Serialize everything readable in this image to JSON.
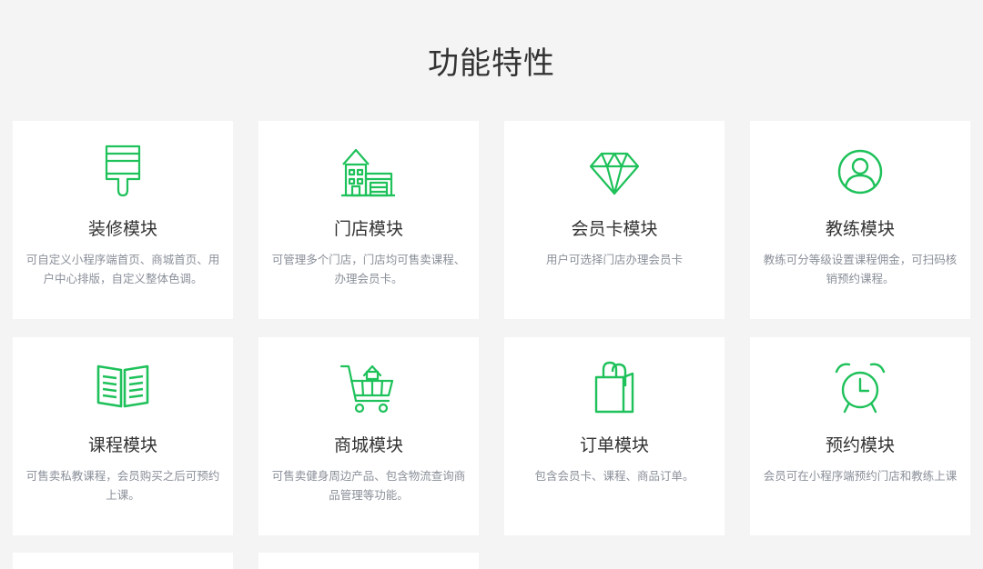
{
  "page": {
    "title": "功能特性"
  },
  "colors": {
    "background": "#f4f4f4",
    "card": "#ffffff",
    "accent": "#1ec15a",
    "title_text": "#333333",
    "desc_text": "#8a8f99"
  },
  "features": [
    {
      "icon": "paint-brush-icon",
      "name": "装修模块",
      "desc": "可自定义小程序端首页、商城首页、用户中心排版，自定义整体色调。"
    },
    {
      "icon": "store-house-icon",
      "name": "门店模块",
      "desc": "可管理多个门店，门店均可售卖课程、办理会员卡。"
    },
    {
      "icon": "diamond-icon",
      "name": "会员卡模块",
      "desc": "用户可选择门店办理会员卡"
    },
    {
      "icon": "user-avatar-icon",
      "name": "教练模块",
      "desc": "教练可分等级设置课程佣金，可扫码核销预约课程。"
    },
    {
      "icon": "open-book-icon",
      "name": "课程模块",
      "desc": "可售卖私教课程，会员购买之后可预约上课。"
    },
    {
      "icon": "shopping-cart-icon",
      "name": "商城模块",
      "desc": "可售卖健身周边产品、包含物流查询商品管理等功能。"
    },
    {
      "icon": "shopping-bag-icon",
      "name": "订单模块",
      "desc": "包含会员卡、课程、商品订单。"
    },
    {
      "icon": "alarm-clock-icon",
      "name": "预约模块",
      "desc": "会员可在小程序端预约门店和教练上课"
    }
  ]
}
